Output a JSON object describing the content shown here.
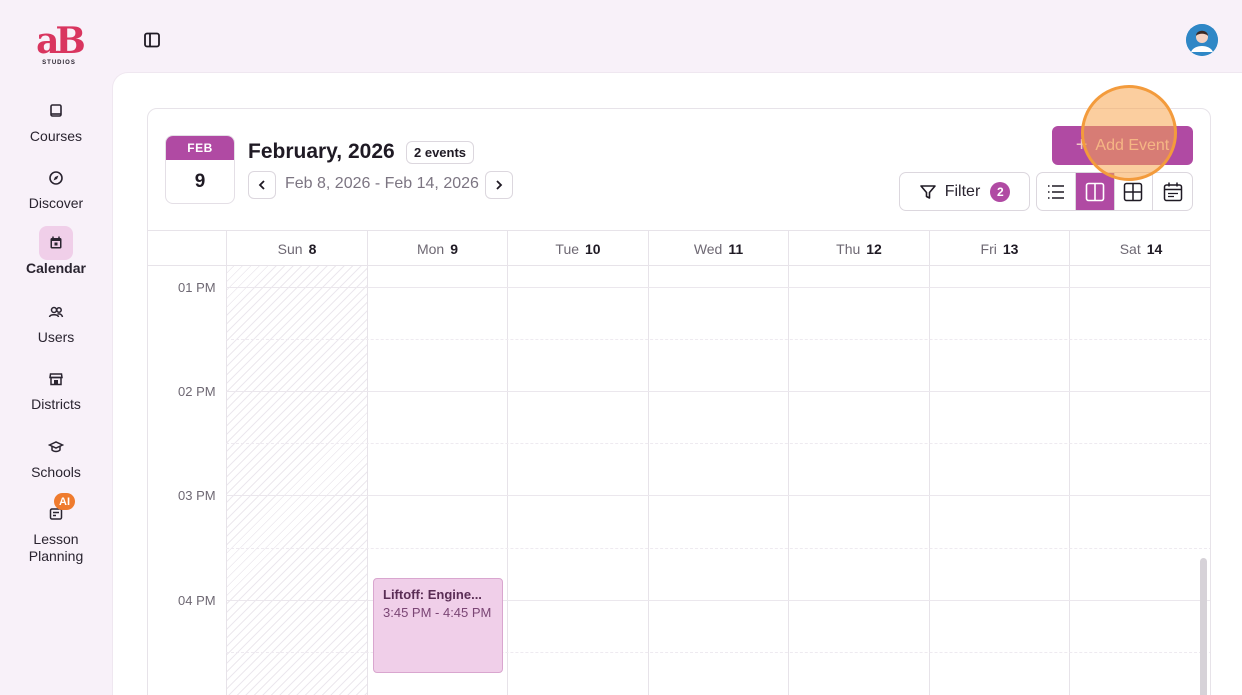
{
  "brand": {
    "logo_text": "aB",
    "logo_sub": "STUDIOS",
    "color": "#d9355f"
  },
  "sidebar": {
    "items": [
      {
        "label": "Courses",
        "icon": "book-icon",
        "active": false
      },
      {
        "label": "Discover",
        "icon": "compass-icon",
        "active": false
      },
      {
        "label": "Calendar",
        "icon": "calendar-icon",
        "active": true
      },
      {
        "label": "Users",
        "icon": "users-icon",
        "active": false
      },
      {
        "label": "Districts",
        "icon": "store-icon",
        "active": false
      },
      {
        "label": "Schools",
        "icon": "graduation-cap-icon",
        "active": false
      },
      {
        "label": "Lesson Planning",
        "icon": "note-icon",
        "active": false,
        "badge": "AI"
      }
    ]
  },
  "header": {
    "sidebar_toggle_icon": "panel-left-icon",
    "avatar_icon": "user-avatar-icon"
  },
  "calendar": {
    "badge_month": "FEB",
    "badge_day": "9",
    "title": "February, 2026",
    "events_count": "2 events",
    "range": "Feb 8, 2026 - Feb 14, 2026",
    "add_event_label": "Add Event",
    "filter_label": "Filter",
    "filter_count": "2",
    "views": [
      "list-view-icon",
      "week-view-icon",
      "month-view-icon",
      "calendar-view-icon"
    ],
    "active_view": "week-view-icon",
    "accent": "#b04aa3",
    "days": [
      {
        "name": "Sun",
        "num": "8"
      },
      {
        "name": "Mon",
        "num": "9"
      },
      {
        "name": "Tue",
        "num": "10"
      },
      {
        "name": "Wed",
        "num": "11"
      },
      {
        "name": "Thu",
        "num": "12"
      },
      {
        "name": "Fri",
        "num": "13"
      },
      {
        "name": "Sat",
        "num": "14"
      }
    ],
    "times": [
      "01 PM",
      "02 PM",
      "03 PM",
      "04 PM"
    ],
    "events": [
      {
        "title": "Liftoff: Engine...",
        "time": "3:45 PM - 4:45 PM",
        "day": "Mon"
      }
    ]
  }
}
